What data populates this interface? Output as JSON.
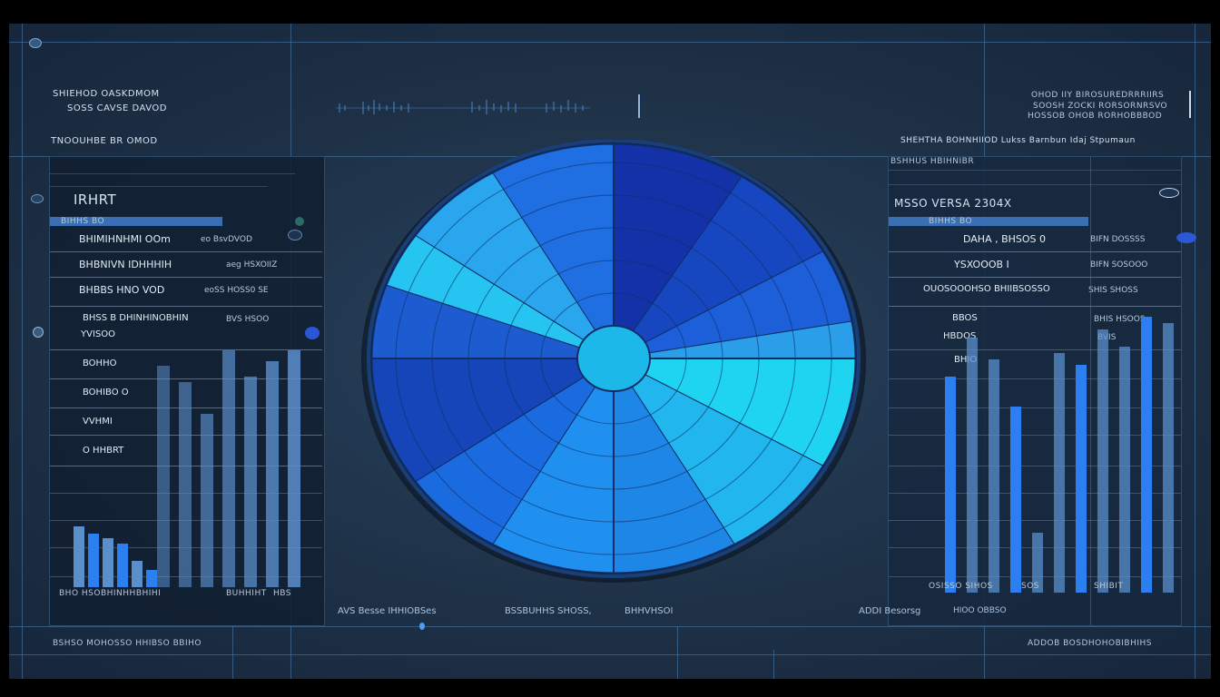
{
  "header_left": {
    "title_line1": "SHIEHOD OASKDMOM",
    "title_line2": "SOSS CAVSE DAVOD",
    "section": "TNOOUHBE BR OMOD"
  },
  "header_right": {
    "line1": "OHOD IIY BIROSUREDRRRIIRS",
    "line2": "SOOSH ZOCKI RORSORNRSVO",
    "line3": "HOSSOB OHOB RORHOBBBOD",
    "section": "SHEHTHA BOHNHIIOD Lukss Barnbun Idaj Stpumaun"
  },
  "left_panel": {
    "top_label": "IRHRT",
    "tag": "BIHHS BO",
    "rows": [
      {
        "label": "BHIMIHNHMI OOm",
        "value": "eo BsvDVOD"
      },
      {
        "label": "BHBNIVN IDHHHIH",
        "value": "aeg HSXOIIZ"
      },
      {
        "label": "BHBBS HNO VOD",
        "value": "eoSS HOSS0 SE"
      },
      {
        "label": "BHSS B DHINHINOBHIN",
        "value": "BVS HSOO"
      },
      {
        "label": "YVISOO",
        "value": ""
      },
      {
        "label": "BOHHO",
        "value": ""
      },
      {
        "label": "BOHIBO O",
        "value": ""
      },
      {
        "label": "VVHMI",
        "value": ""
      },
      {
        "label": "O HHBRT",
        "value": ""
      }
    ],
    "bars_small": [
      0.5,
      0.44,
      0.4,
      0.36,
      0.22,
      0.14
    ],
    "bars_tall": [
      0.84,
      0.78,
      0.66,
      0.9,
      0.8,
      0.86,
      0.9
    ],
    "footer": "BHO HSOBHINHHBHIHI",
    "footer_right": "BUHHIHT",
    "footer_far": "HBS"
  },
  "right_panel": {
    "top_label": "BSHHUS HBIHNIBR",
    "sub_label": "MSSO VERSA 2304X",
    "tag": "BIHHS BO",
    "rows": [
      {
        "label": "DAHA , BHSOS 0",
        "value": "BIFN DOSSSS"
      },
      {
        "label": "YSXOOOB I",
        "value": "BIFN SOSOOO"
      },
      {
        "label": "OUOSOOOHSO BHIIBSOSSO",
        "value": "SHIS SHOSS"
      },
      {
        "label": "BBOS",
        "value": "BHIS HSOOS"
      },
      {
        "label": "HBDOS",
        "value": "BVIS"
      },
      {
        "label": "BHIO",
        "value": ""
      }
    ],
    "bars": [
      0.72,
      0.85,
      0.78,
      0.62,
      0.2,
      0.8,
      0.76,
      0.88,
      0.82,
      0.92,
      0.9
    ],
    "footer": "OSISSO SIHOS",
    "footer_mid": "SOS",
    "footer_right": "SHIBIT"
  },
  "radar": {
    "accent": "#1fd4f0",
    "deep": "#1431a8",
    "mid": "#1c5fd8"
  },
  "bottom": {
    "labels": [
      "AVS Besse IHHIOBSes",
      "BSSBUHHS SHOSS,",
      "BHHVHSOI"
    ],
    "right_label": "ADDI Besorsg",
    "right_small": "HIOO OBBSO",
    "left_footer": "BSHSO MOHOSSO HHIBSO BBIHO",
    "right_footer": "ADDOB BOSDHOHOBIBHIHS"
  },
  "colors": {
    "bg": "#1e3147",
    "line": "#3e6f9c",
    "bar_light": "#5a8fcc",
    "bar_bright": "#2b7ff0"
  }
}
